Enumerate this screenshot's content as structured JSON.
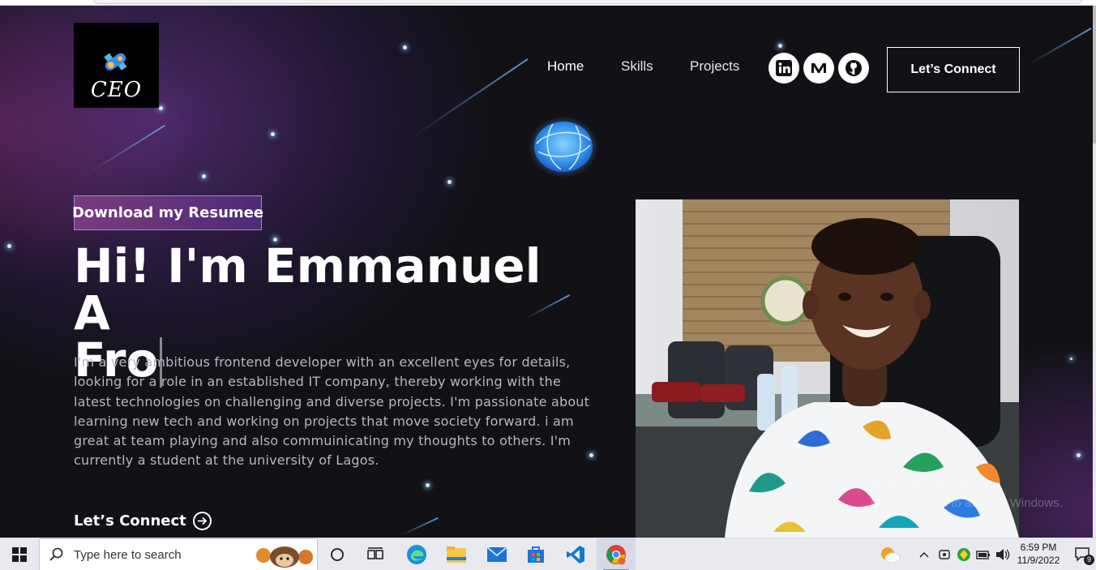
{
  "site": {
    "logo_text": "CEO",
    "nav": {
      "home": "Home",
      "skills": "Skills",
      "projects": "Projects"
    },
    "social": [
      "linkedin-icon",
      "medium-icon",
      "github-icon"
    ],
    "connect_button": "Let’s Connect",
    "resume_button": "Download my Resumee",
    "hero_title_line1": "Hi! I'm Emmanuel A",
    "hero_title_line2": "Fro",
    "bio": "I'm a very ambitious frontend developer with an excellent eyes for details, looking for a role in an established IT company, thereby working with the latest technologies on challenging and diverse projects. I'm passionate about learning new tech and working on projects that move society forward. i am great at team playing and also commuinicating my thoughts to others. I'm currently a student at the university of Lagos.",
    "connect_link": "Let’s Connect",
    "colors": {
      "background": "#121216",
      "accent_purple": "#7a3b7e",
      "star_blue": "#cfe9ff"
    }
  },
  "os": {
    "watermark_title": "Activate Windows",
    "watermark_sub": "Go to Settings to activate Windows.",
    "taskbar": {
      "search_placeholder": "Type here to search",
      "pinned_icons": [
        "windows-start-icon",
        "search-icon",
        "cortana-icon",
        "task-view-icon",
        "edge-icon",
        "file-explorer-icon",
        "mail-icon",
        "store-icon",
        "vscode-icon",
        "chrome-icon"
      ],
      "tray_icons": [
        "weather-icon",
        "chevron-up-icon",
        "meet-icon",
        "shield-icon",
        "battery-icon",
        "volume-icon"
      ],
      "time": "6:59 PM",
      "date": "11/9/2022",
      "notification_count": "9"
    }
  }
}
